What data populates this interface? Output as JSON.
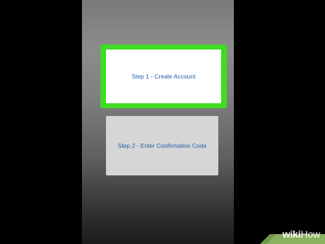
{
  "screen": {
    "background_top": "#8c8c8c",
    "background_bottom": "#1c1c1c"
  },
  "steps": [
    {
      "label": "Step 1 - Create Account",
      "highlighted": true,
      "highlight_color": "#3fdc22"
    },
    {
      "label": "Step 2 - Enter Confirmation Code",
      "highlighted": false
    }
  ],
  "watermark": {
    "brand": "wikiHow",
    "brand_part_1": "wiki",
    "brand_part_2": "How"
  }
}
